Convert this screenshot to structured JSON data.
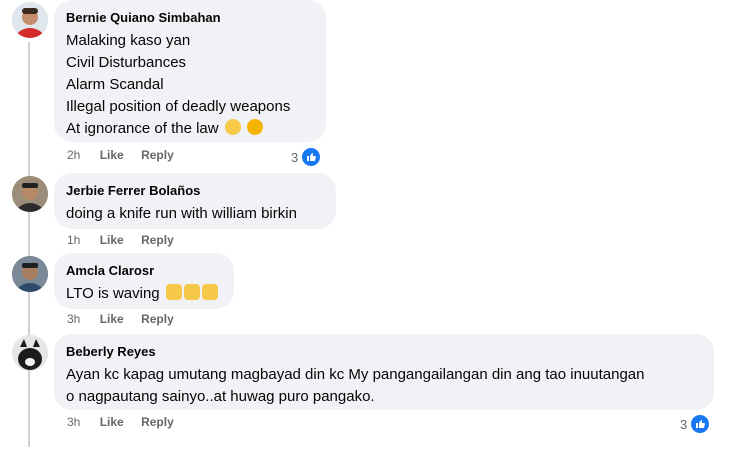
{
  "comments": [
    {
      "name": "Bernie Quiano Simbahan",
      "lines": [
        "Malaking kaso yan",
        "Civil Disturbances",
        "Alarm Scandal",
        "Illegal position of deadly weapons",
        "At ignorance of the law"
      ],
      "time": "2h",
      "like_label": "Like",
      "reply_label": "Reply",
      "reaction_count": "3",
      "reaction_icon": "like-icon"
    },
    {
      "name": "Jerbie Ferrer Bolaños",
      "lines": [
        "doing a knife run with william birkin"
      ],
      "time": "1h",
      "like_label": "Like",
      "reply_label": "Reply"
    },
    {
      "name": "Amcla Clarosr",
      "lines": [
        "LTO is waving"
      ],
      "time": "3h",
      "like_label": "Like",
      "reply_label": "Reply"
    },
    {
      "name": "Beberly Reyes",
      "lines": [
        "Ayan kc kapag umutang magbayad din kc My pangangailangan din ang tao inuutangan",
        "o nagpautang sainyo..at huwag puro pangako."
      ],
      "time": "3h",
      "like_label": "Like",
      "reply_label": "Reply",
      "reaction_count": "3",
      "reaction_icon": "like-icon"
    }
  ],
  "colors": {
    "bubble": "#f0f2f5",
    "meta": "#65676b",
    "like_blue": "#1877f2"
  }
}
